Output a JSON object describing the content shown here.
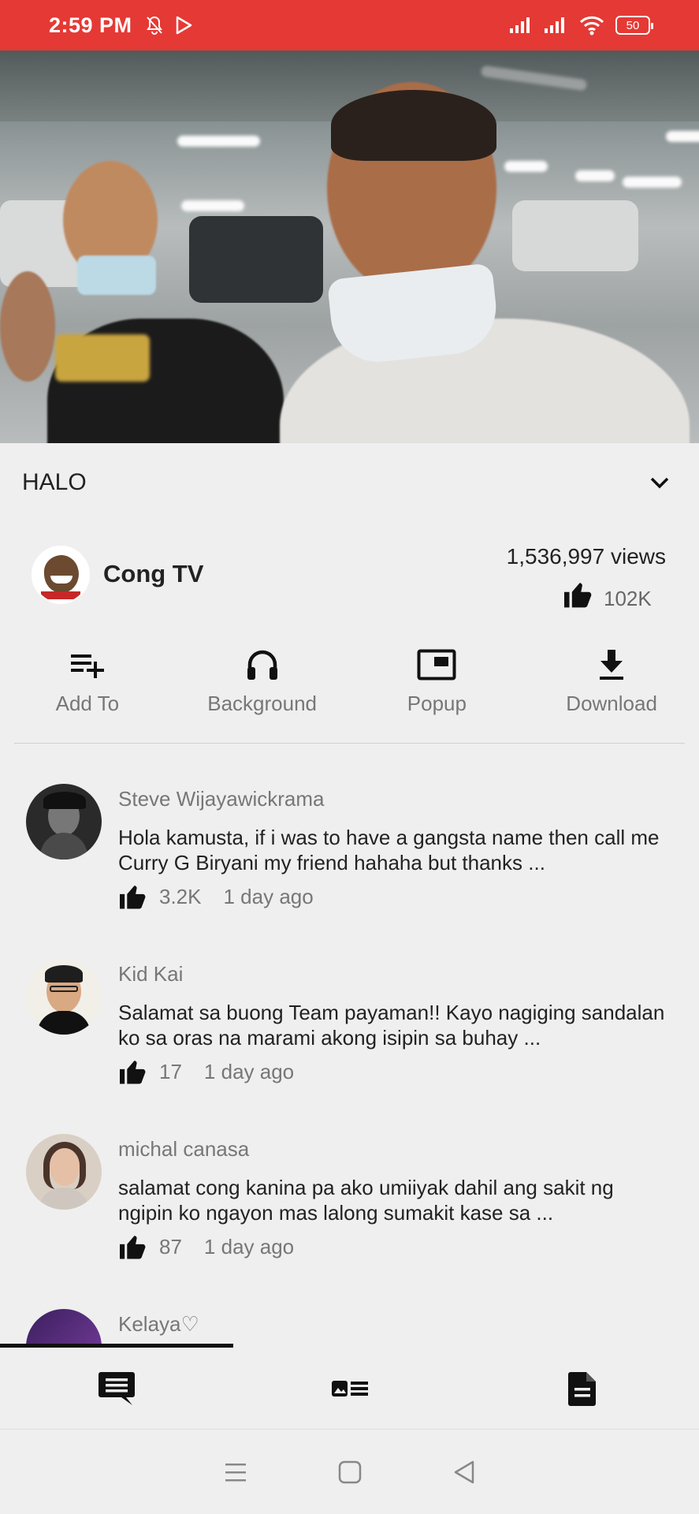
{
  "status_bar": {
    "time": "2:59 PM",
    "battery": "50"
  },
  "video": {
    "title": "HALO"
  },
  "channel": {
    "name": "Cong TV",
    "views": "1,536,997 views",
    "likes": "102K"
  },
  "actions": [
    {
      "label": "Add To",
      "icon": "playlist-add-icon"
    },
    {
      "label": "Background",
      "icon": "headphones-icon"
    },
    {
      "label": "Popup",
      "icon": "picture-in-picture-icon"
    },
    {
      "label": "Download",
      "icon": "download-icon"
    }
  ],
  "comments": [
    {
      "author": "Steve Wijayawickrama",
      "text": "Hola kamusta, if i was to have a gangsta name then call me Curry G Biryani my friend hahaha but thanks ...",
      "likes": "3.2K",
      "age": "1 day ago"
    },
    {
      "author": "Kid Kai",
      "text": "Salamat sa buong Team payaman!! Kayo nagiging sandalan ko sa oras na marami akong isipin sa buhay ...",
      "likes": "17",
      "age": "1 day ago"
    },
    {
      "author": "michal canasa",
      "text": "salamat cong kanina pa ako umiiyak dahil ang sakit ng ngipin ko ngayon mas lalong sumakit kase sa ...",
      "likes": "87",
      "age": "1 day ago"
    },
    {
      "author": "Kelaya♡"
    }
  ],
  "tabs": [
    {
      "name": "comments",
      "icon": "comment-icon",
      "selected": true
    },
    {
      "name": "related",
      "icon": "related-videos-icon",
      "selected": false
    },
    {
      "name": "description",
      "icon": "description-icon",
      "selected": false
    }
  ],
  "colors": {
    "status_bar": "#e53935",
    "background": "#efefef"
  }
}
